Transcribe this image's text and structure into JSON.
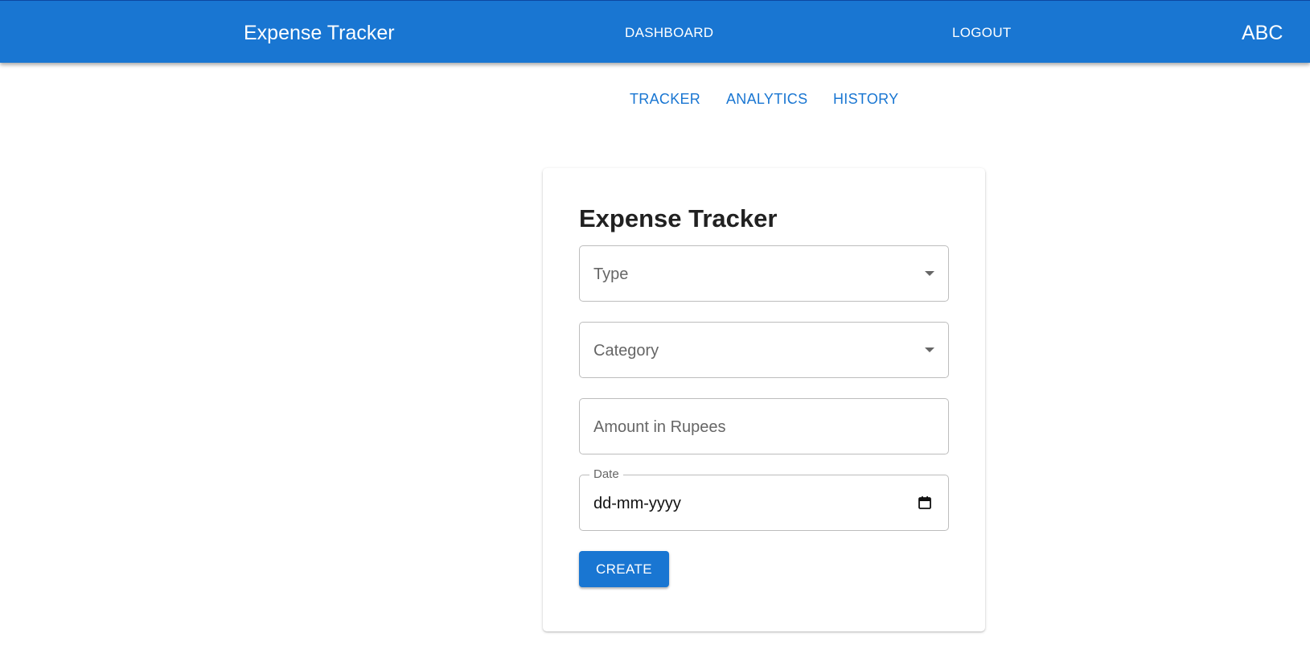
{
  "header": {
    "brand": "Expense Tracker",
    "nav": {
      "dashboard": "DASHBOARD",
      "logout": "LOGOUT"
    },
    "user": "ABC",
    "color": "#1976d2"
  },
  "tabs": [
    {
      "label": "TRACKER"
    },
    {
      "label": "ANALYTICS"
    },
    {
      "label": "HISTORY"
    }
  ],
  "form": {
    "title": "Expense Tracker",
    "type": {
      "placeholder": "Type",
      "icon": "chevron-down-icon"
    },
    "category": {
      "placeholder": "Category",
      "icon": "chevron-down-icon"
    },
    "amount": {
      "placeholder": "Amount in Rupees"
    },
    "date": {
      "label": "Date",
      "value": "dd-mm-yyyy",
      "icon": "calendar-icon"
    },
    "submit_label": "CREATE"
  }
}
